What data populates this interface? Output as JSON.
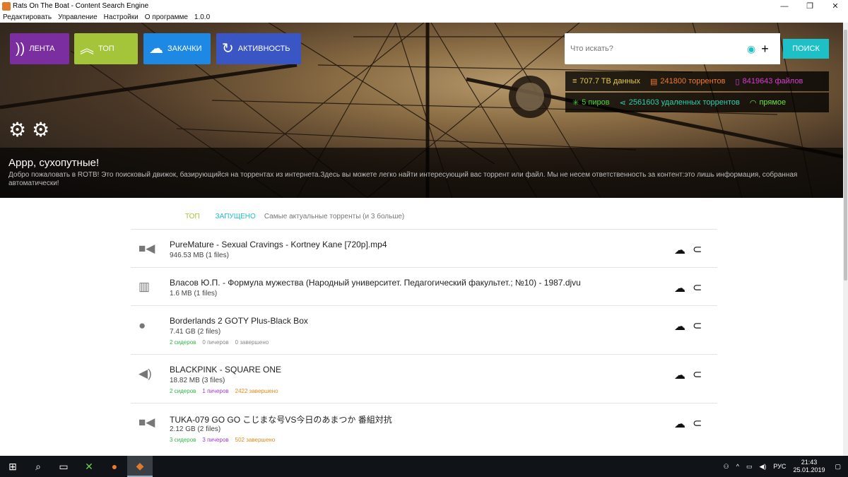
{
  "window": {
    "title": "Rats On The Boat - Content Search Engine",
    "minimize": "—",
    "maximize": "❐",
    "close": "✕"
  },
  "menu": [
    "Редактировать",
    "Управление",
    "Настройки",
    "О программе",
    "1.0.0"
  ],
  "nav": [
    {
      "label": "ЛЕНТА",
      "icon": "feed-icon",
      "color": "#7a2ea0"
    },
    {
      "label": "ТОП",
      "icon": "top-chevrons-icon",
      "color": "#a4c43a"
    },
    {
      "label": "ЗАКАЧКИ",
      "icon": "cloud-download-icon",
      "color": "#1e88e5"
    },
    {
      "label": "АКТИВНОСТЬ",
      "icon": "activity-cycle-icon",
      "color": "#3a56c4"
    }
  ],
  "search": {
    "placeholder": "Что искать?",
    "button": "ПОИСК"
  },
  "stats": {
    "data": "707.7 TB данных",
    "torrents": "241800 торрентов",
    "files": "8419643 файлов",
    "peers": "5 пиров",
    "removed": "2561603 удаленных торрентов",
    "direct": "прямое"
  },
  "banner": {
    "title": "Аррр, сухопутные!",
    "text": "Добро пожаловать в ROTB! Это поисковый движок, базирующийся на торрентах из интернета.Здесь вы можете легко найти интересующий вас торрент или файл. Мы не несем ответственность за контент:это лишь информация, собранная автоматически!"
  },
  "tabs": {
    "top": "ТОП",
    "started": "ЗАПУЩЕНО",
    "subtitle": "Самые актуальные торренты (и 3 больше)"
  },
  "torrents": [
    {
      "name": "PureMature - Sexual Cravings - Kortney Kane [720p].mp4",
      "size": "946.53 MB (1 files)",
      "icon": "video-camera-icon",
      "seeders": "",
      "leechers": "",
      "completed": ""
    },
    {
      "name": "Власов Ю.П. - Формула мужества (Народный университет. Педагогический факультет.; №10) - 1987.djvu",
      "size": "1.6 MB (1 files)",
      "icon": "book-icon",
      "seeders": "",
      "leechers": "",
      "completed": ""
    },
    {
      "name": "Borderlands 2 GOTY Plus-Black Box",
      "size": "7.41 GB (2 files)",
      "icon": "disc-icon",
      "seeders": "2 сидеров",
      "leechers": "0 пичеров",
      "completed": "0 завершено"
    },
    {
      "name": "BLACKPINK - SQUARE ONE",
      "size": "18.82 MB (3 files)",
      "icon": "speaker-icon",
      "seeders": "2 сидеров",
      "leechers": "1 пичеров",
      "completed": "2422 завершено"
    },
    {
      "name": "TUKA-079 GO GO こじまな号VS今日のあまつか 番組対抗",
      "size": "2.12 GB (2 files)",
      "icon": "video-camera-icon",
      "seeders": "3 сидеров",
      "leechers": "3 пичеров",
      "completed": "502 завершено"
    }
  ],
  "taskbar": {
    "lang": "РУС",
    "time": "21:43",
    "date": "25.01.2019"
  },
  "colors": {
    "accent": "#1ec0c8",
    "seeders": "#2eb84a",
    "leechers": "#a43ad0",
    "completed": "#e08a1e"
  }
}
